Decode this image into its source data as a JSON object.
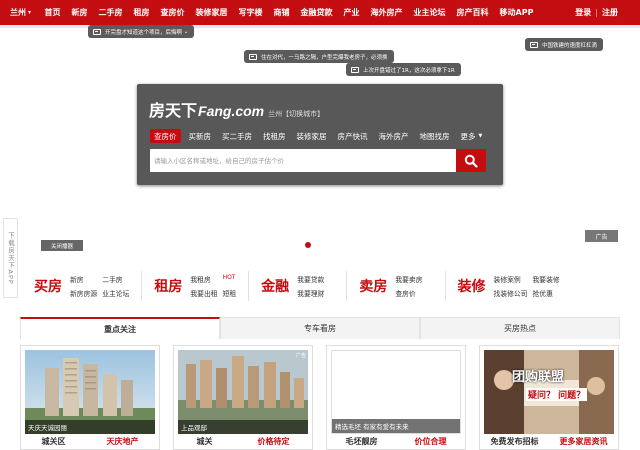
{
  "topnav": {
    "city": "兰州",
    "items": [
      "首页",
      "新房",
      "二手房",
      "租房",
      "查房价",
      "装修家居",
      "写字楼",
      "商铺",
      "金融贷款",
      "产业",
      "海外房产",
      "业主论坛",
      "房产百科",
      "移动APP"
    ],
    "login": "登录",
    "separator": "|",
    "register": "注册"
  },
  "bubbles": [
    "开完盘才知道这个项目，后悔啊",
    "住在对代，一马路之隔，户型完爆我老房子，必须换",
    "上次开盘错过了1R，这次必须拿下1R",
    "中国铁建的速度杠杠滴"
  ],
  "panel": {
    "logo_cn": "房天下",
    "logo_en": "Fang.com",
    "city_label": "兰州【切换城市】",
    "tabs": [
      "查房价",
      "买新房",
      "买二手房",
      "找租房",
      "装修家居",
      "房产快讯",
      "海外房产",
      "地图找房",
      "更多"
    ],
    "active_tab": "查房价",
    "search_placeholder": "请输入小区名称或地址，给自己的房子估个价"
  },
  "side_app": "下载房天下APP",
  "ad": {
    "close_label": "关闭播器",
    "ad_label": "广告"
  },
  "categories": [
    {
      "title": "买房",
      "links": [
        "新房",
        "二手房",
        "新房房源",
        "业主论坛"
      ]
    },
    {
      "title": "租房",
      "links": [
        "我租房",
        "HOT",
        "我要出租",
        "短租"
      ]
    },
    {
      "title": "金融",
      "links": [
        "我要贷款",
        "我要理财"
      ]
    },
    {
      "title": "卖房",
      "links": [
        "我要卖房",
        "查房价"
      ]
    },
    {
      "title": "装修",
      "links": [
        "装修案例",
        "我要装修",
        "找装修公司",
        "抢优惠"
      ]
    }
  ],
  "content_tabs": [
    "重点关注",
    "专车看房",
    "买房热点"
  ],
  "cards": [
    {
      "caption": "天庆天诚园丽",
      "tag": "",
      "left": "城关区",
      "right": "天庆地产"
    },
    {
      "caption": "上品观邸",
      "tag": "广告",
      "left": "城关",
      "right": "价格待定"
    },
    {
      "caption": "精选毛坯 有家有爱有未来",
      "tag": "",
      "left": "毛坯靓房",
      "right": "价位合理"
    },
    {
      "caption": "",
      "tag": "",
      "left": "免费发布招标",
      "right": "更多家居资讯"
    }
  ],
  "card4_banner": "团购联盟",
  "card4_sub": "疑问？  问题？"
}
